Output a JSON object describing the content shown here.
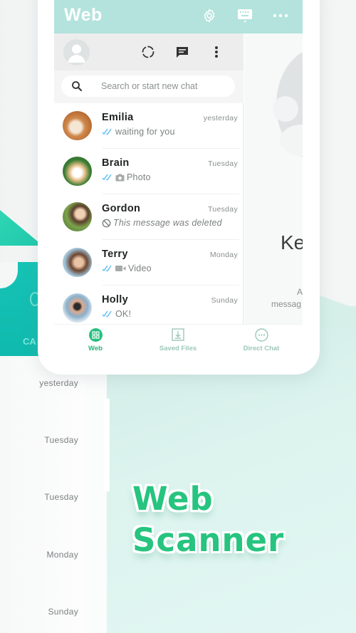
{
  "app": {
    "title": "Web",
    "header_icons": [
      "gear-icon",
      "keyboard-icon",
      "more-horizontal-icon"
    ]
  },
  "pane_toolbar": {
    "icons": [
      "status-icon",
      "new-chat-icon",
      "more-vertical-icon"
    ]
  },
  "search": {
    "placeholder": "Search or start new chat",
    "value": ""
  },
  "chats": [
    {
      "name": "Emilia",
      "time": "yesterday",
      "preview": "waiting for you",
      "type": "text",
      "read": true
    },
    {
      "name": "Brain",
      "time": "Tuesday",
      "preview": "Photo",
      "type": "photo",
      "read": true
    },
    {
      "name": "Gordon",
      "time": "Tuesday",
      "preview": "This message was deleted",
      "type": "deleted",
      "read": false
    },
    {
      "name": "Terry",
      "time": "Monday",
      "preview": "Video",
      "type": "video",
      "read": true
    },
    {
      "name": "Holly",
      "time": "Sunday",
      "preview": "OK!",
      "type": "text",
      "read": true
    }
  ],
  "right_pane": {
    "heading": "Ke",
    "line1": "A",
    "line2": "messag"
  },
  "bottom_nav": [
    {
      "label": "Web",
      "icon": "qr-grid-icon",
      "active": true
    },
    {
      "label": "Saved Files",
      "icon": "download-box-icon",
      "active": false
    },
    {
      "label": "Direct Chat",
      "icon": "chat-dots-icon",
      "active": false
    }
  ],
  "background_times": [
    "yesterday",
    "Tuesday",
    "Tuesday",
    "Monday",
    "Sunday"
  ],
  "background_card_label": "CA",
  "headline": {
    "line1": "Web",
    "line2": "Scanner"
  },
  "colors": {
    "header": "#b3e3dc",
    "accent_green": "#26c47f",
    "read_tick": "#5bbcf0",
    "teal": "#16c3b5"
  }
}
